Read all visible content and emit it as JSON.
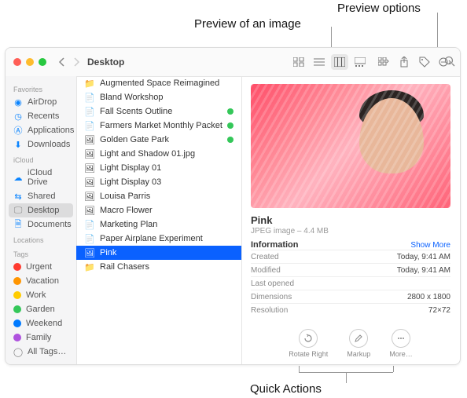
{
  "annotations": {
    "preview_image": "Preview of an image",
    "preview_options": "Preview options",
    "quick_actions": "Quick Actions"
  },
  "window": {
    "title": "Desktop"
  },
  "sidebar": {
    "headers": [
      "Favorites",
      "iCloud",
      "Locations",
      "Tags"
    ],
    "favorites": [
      "AirDrop",
      "Recents",
      "Applications",
      "Downloads"
    ],
    "icloud": [
      "iCloud Drive",
      "Shared",
      "Desktop",
      "Documents"
    ],
    "tags": [
      "Urgent",
      "Vacation",
      "Work",
      "Garden",
      "Weekend",
      "Family",
      "All Tags…"
    ]
  },
  "files": [
    {
      "name": "Augmented Space Reimagined"
    },
    {
      "name": "Bland Workshop"
    },
    {
      "name": "Fall Scents Outline",
      "tag": "green"
    },
    {
      "name": "Farmers Market Monthly Packet",
      "tag": "green"
    },
    {
      "name": "Golden Gate Park",
      "tag": "green"
    },
    {
      "name": "Light and Shadow 01.jpg"
    },
    {
      "name": "Light Display 01"
    },
    {
      "name": "Light Display 03"
    },
    {
      "name": "Louisa Parris"
    },
    {
      "name": "Macro Flower"
    },
    {
      "name": "Marketing Plan"
    },
    {
      "name": "Paper Airplane Experiment"
    },
    {
      "name": "Pink",
      "selected": true
    },
    {
      "name": "Rail Chasers"
    }
  ],
  "preview": {
    "name": "Pink",
    "meta": "JPEG image – 4.4 MB",
    "information_label": "Information",
    "show_more": "Show More",
    "info": [
      {
        "k": "Created",
        "v": "Today, 9:41 AM"
      },
      {
        "k": "Modified",
        "v": "Today, 9:41 AM"
      },
      {
        "k": "Last opened",
        "v": ""
      },
      {
        "k": "Dimensions",
        "v": "2800 x 1800"
      },
      {
        "k": "Resolution",
        "v": "72×72"
      }
    ],
    "quick_actions": [
      "Rotate Right",
      "Markup",
      "More…"
    ]
  }
}
